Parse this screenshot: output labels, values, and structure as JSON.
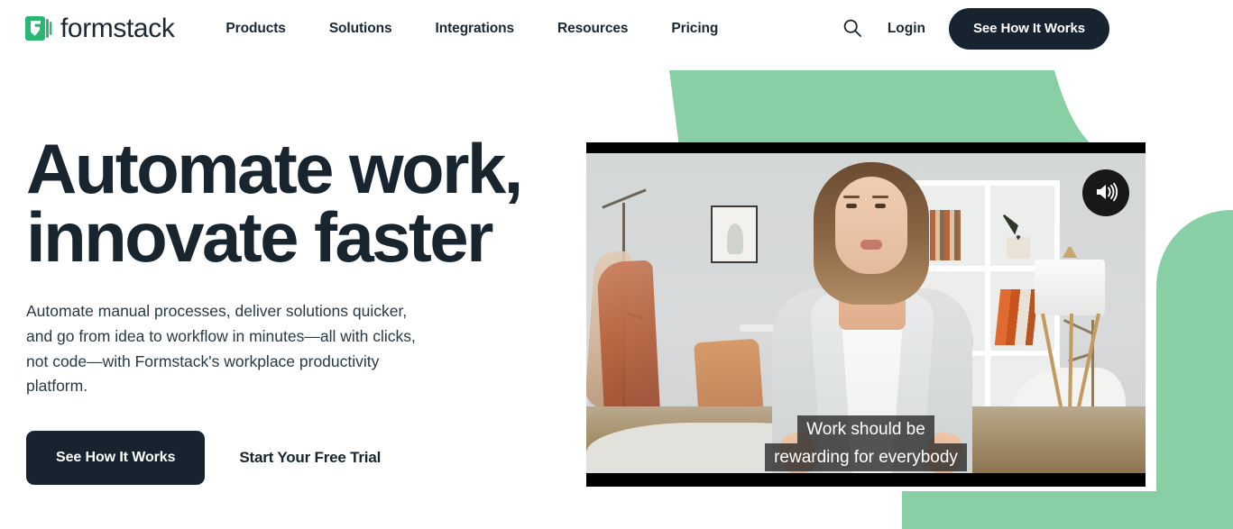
{
  "brand": {
    "name": "formstack",
    "logo_icon": "formstack-bolt-logo",
    "accent_green": "#88cfa6",
    "dark_navy": "#17242f"
  },
  "header": {
    "nav": [
      {
        "label": "Products"
      },
      {
        "label": "Solutions"
      },
      {
        "label": "Integrations"
      },
      {
        "label": "Resources"
      },
      {
        "label": "Pricing"
      }
    ],
    "search_icon": "search-icon",
    "login_label": "Login",
    "cta_label": "See How It Works"
  },
  "hero": {
    "title_line1": "Automate work,",
    "title_line2": "innovate faster",
    "subtitle": "Automate manual processes, deliver solutions quicker, and go from idea to workflow in minutes—all with clicks, not code—with Formstack's workplace productivity platform.",
    "primary_cta": "See How It Works",
    "secondary_cta": "Start Your Free Trial"
  },
  "video": {
    "audio_icon": "volume-on-icon",
    "caption_line1": "Work should be",
    "caption_line2": "rewarding for everybody"
  }
}
